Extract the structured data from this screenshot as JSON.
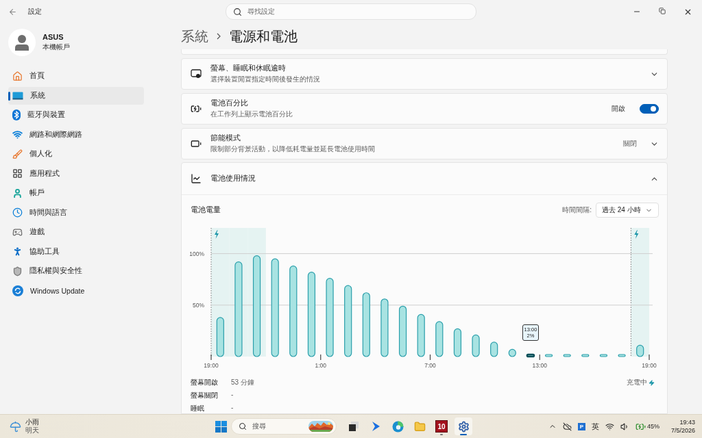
{
  "window": {
    "title": "設定",
    "search_placeholder": "尋找設定"
  },
  "sidebar": {
    "user": {
      "name": "ASUS",
      "subtitle": "本機帳戶"
    },
    "items": [
      {
        "kind": "home",
        "label": "首頁",
        "selected": false
      },
      {
        "kind": "system",
        "label": "系統",
        "selected": true
      },
      {
        "kind": "bluetooth",
        "label": "藍牙與裝置",
        "selected": false
      },
      {
        "kind": "network",
        "label": "網路和網際網路",
        "selected": false
      },
      {
        "kind": "personalization",
        "label": "個人化",
        "selected": false
      },
      {
        "kind": "apps",
        "label": "應用程式",
        "selected": false
      },
      {
        "kind": "accounts",
        "label": "帳戶",
        "selected": false
      },
      {
        "kind": "time",
        "label": "時間與語言",
        "selected": false
      },
      {
        "kind": "gaming",
        "label": "遊戲",
        "selected": false
      },
      {
        "kind": "accessibility",
        "label": "協助工具",
        "selected": false
      },
      {
        "kind": "privacy",
        "label": "隱私權與安全性",
        "selected": false
      },
      {
        "kind": "update",
        "label": "Windows Update",
        "selected": false
      }
    ]
  },
  "breadcrumb": {
    "parent": "系統",
    "current": "電源和電池"
  },
  "settings": [
    {
      "kind": "sleep",
      "title": "螢幕、睡眠和休眠逾時",
      "subtitle": "選擇裝置閒置指定時間後發生的情況",
      "expanded": false
    },
    {
      "kind": "percentage",
      "title": "電池百分比",
      "subtitle": "在工作列上顯示電池百分比",
      "state_label": "開啟",
      "on": true
    },
    {
      "kind": "saver",
      "title": "節能模式",
      "subtitle": "限制部分背景活動，以降低耗電量並延長電池使用時間",
      "value": "關閉",
      "expanded": false
    }
  ],
  "battery_usage": {
    "title": "電池使用情況",
    "expanded": true,
    "chart_title": "電池電量",
    "interval_label": "時間間隔:",
    "interval_value": "過去 24 小時",
    "chart_data": {
      "type": "bar",
      "categories": [
        "19:00",
        null,
        null,
        null,
        null,
        null,
        "1:00",
        null,
        null,
        null,
        null,
        null,
        "7:00",
        null,
        null,
        null,
        null,
        null,
        "13:00",
        null,
        null,
        null,
        null,
        null,
        "19:00"
      ],
      "values": [
        38,
        92,
        98,
        95,
        88,
        82,
        76,
        69,
        62,
        56,
        49,
        41,
        34,
        27,
        21,
        14,
        7,
        2,
        2,
        2,
        2,
        2,
        2,
        11,
        null
      ],
      "ylim": [
        0,
        125
      ],
      "yticks": [
        {
          "value": 50,
          "label": "50%"
        },
        {
          "value": 100,
          "label": "100%"
        }
      ],
      "annotations": [
        "13:00 2%"
      ]
    },
    "hours": [
      {
        "charging": true,
        "selected": false
      },
      {
        "charging": true,
        "selected": false
      },
      {
        "charging": true,
        "selected": false
      },
      {
        "charging": false,
        "selected": false
      },
      {
        "charging": false,
        "selected": false
      },
      {
        "charging": false,
        "selected": false
      },
      {
        "charging": false,
        "selected": false
      },
      {
        "charging": false,
        "selected": false
      },
      {
        "charging": false,
        "selected": false
      },
      {
        "charging": false,
        "selected": false
      },
      {
        "charging": false,
        "selected": false
      },
      {
        "charging": false,
        "selected": false
      },
      {
        "charging": false,
        "selected": false
      },
      {
        "charging": false,
        "selected": false
      },
      {
        "charging": false,
        "selected": false
      },
      {
        "charging": false,
        "selected": false
      },
      {
        "charging": false,
        "selected": false
      },
      {
        "charging": false,
        "selected": true
      },
      {
        "charging": false,
        "selected": false
      },
      {
        "charging": false,
        "selected": false
      },
      {
        "charging": false,
        "selected": false
      },
      {
        "charging": false,
        "selected": false
      },
      {
        "charging": false,
        "selected": false
      },
      {
        "charging": true,
        "selected": false
      }
    ],
    "stats": [
      {
        "label": "螢幕開啟",
        "value": "53 分鐘"
      },
      {
        "label": "螢幕關閉",
        "value": "-"
      },
      {
        "label": "睡眠",
        "value": "-"
      }
    ],
    "status": "充電中"
  },
  "taskbar": {
    "weather": {
      "condition": "小雨",
      "day": "明天"
    },
    "search_placeholder": "搜尋",
    "apps": [
      {
        "kind": "taskview",
        "running": false,
        "selected": false
      },
      {
        "kind": "arrow",
        "running": false,
        "selected": false
      },
      {
        "kind": "edge",
        "running": false,
        "selected": false
      },
      {
        "kind": "folder",
        "running": false,
        "selected": false
      },
      {
        "kind": "badge",
        "label": "10",
        "running": true,
        "selected": false
      },
      {
        "kind": "settings",
        "running": true,
        "selected": true
      }
    ],
    "tray": {
      "app_label": "P",
      "ime": "英",
      "battery": "45%",
      "time": "19:43",
      "date": "7/5/2026"
    }
  }
}
